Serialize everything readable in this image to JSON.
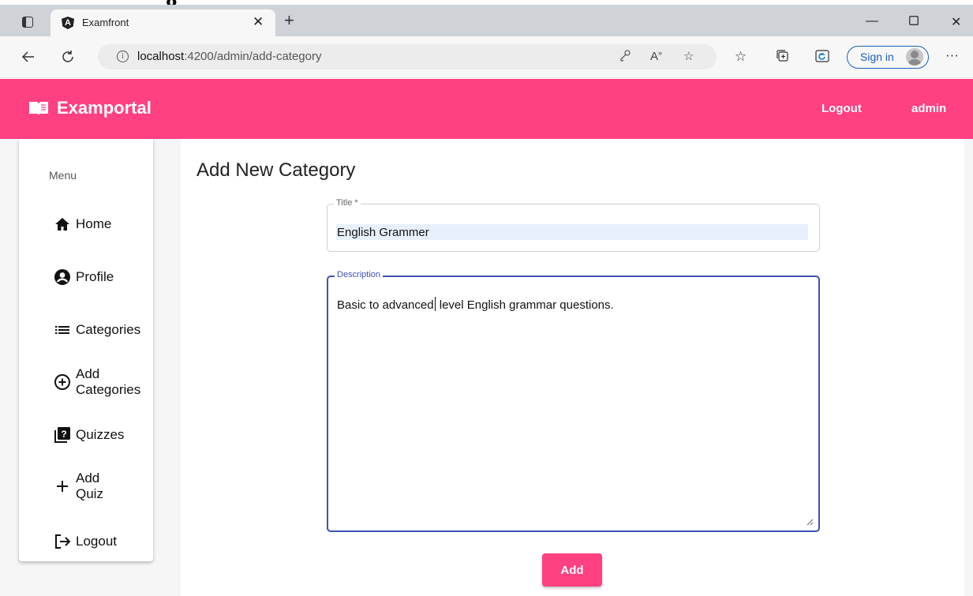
{
  "browser": {
    "top_fragment": "g",
    "tab_title": "Examfront",
    "tab_logo": "A",
    "url_host": "localhost",
    "url_path": ":4200/admin/add-category",
    "sign_in_label": "Sign in",
    "more_label": "···"
  },
  "header": {
    "brand": "Examportal",
    "logout_label": "Logout",
    "user_label": "admin",
    "color": "#ff4081"
  },
  "sidebar": {
    "title": "Menu",
    "items": [
      {
        "label": "Home",
        "icon": "home-icon"
      },
      {
        "label": "Profile",
        "icon": "account-circle-icon"
      },
      {
        "label": "Categories",
        "icon": "list-icon"
      },
      {
        "label_line1": "Add",
        "label_line2": "Categories",
        "icon": "add-circle-icon"
      },
      {
        "label": "Quizzes",
        "icon": "quiz-icon"
      },
      {
        "label_line1": "Add",
        "label_line2": "Quiz",
        "icon": "plus-icon"
      },
      {
        "label": "Logout",
        "icon": "logout-icon"
      }
    ]
  },
  "form": {
    "page_title": "Add New Category",
    "title_label": "Title *",
    "title_value": "English Grammer",
    "description_label": "Description",
    "description_value_before_caret": "Basic to advanced",
    "description_value_after_caret": " level English grammar questions.",
    "submit_label": "Add",
    "focus_color": "#3f51b5"
  }
}
